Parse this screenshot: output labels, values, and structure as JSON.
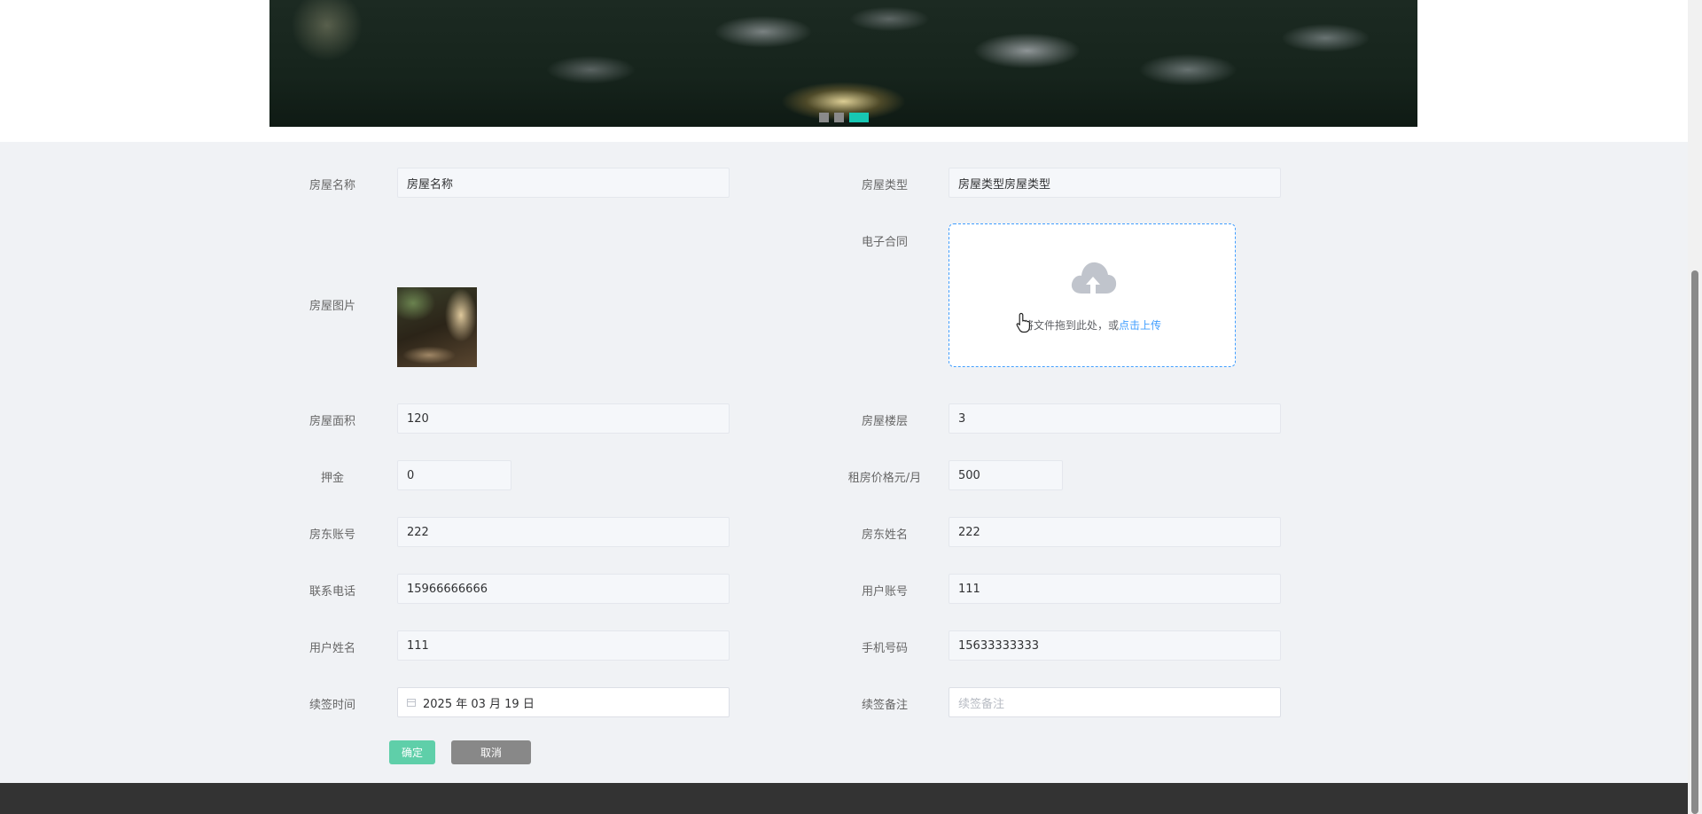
{
  "banner": {
    "indicators": [
      {
        "label": "slide-1",
        "active": false
      },
      {
        "label": "slide-2",
        "active": false
      },
      {
        "label": "slide-3",
        "active": true
      }
    ]
  },
  "form": {
    "house_name": {
      "label": "房屋名称",
      "value": "房屋名称"
    },
    "house_type": {
      "label": "房屋类型",
      "value": "房屋类型房屋类型"
    },
    "contract": {
      "label": "电子合同",
      "upload_hint": "将文件拖到此处，或",
      "upload_link": "点击上传"
    },
    "house_image": {
      "label": "房屋图片"
    },
    "area": {
      "label": "房屋面积",
      "value": "120"
    },
    "floor": {
      "label": "房屋楼层",
      "value": "3"
    },
    "deposit": {
      "label": "押金",
      "value": "0"
    },
    "rent": {
      "label": "租房价格元/月",
      "value": "500"
    },
    "landlord_account": {
      "label": "房东账号",
      "value": "222"
    },
    "landlord_name": {
      "label": "房东姓名",
      "value": "222"
    },
    "phone": {
      "label": "联系电话",
      "value": "15966666666"
    },
    "user_account": {
      "label": "用户账号",
      "value": "111"
    },
    "user_name": {
      "label": "用户姓名",
      "value": "111"
    },
    "mobile": {
      "label": "手机号码",
      "value": "15633333333"
    },
    "renew_time": {
      "label": "续签时间",
      "value": "2025 年 03 月 19 日"
    },
    "renew_note": {
      "label": "续签备注",
      "placeholder": "续签备注"
    }
  },
  "buttons": {
    "confirm": "确定",
    "cancel": "取消"
  },
  "icons": {
    "cloud": "cloud-upload-icon",
    "calendar": "calendar-icon",
    "cursor": "hand-pointer-icon"
  },
  "colors": {
    "accent": "#17c7b3",
    "confirm": "#5fcfa9",
    "cancel": "#888888",
    "link": "#409eff",
    "footer": "#333333"
  }
}
